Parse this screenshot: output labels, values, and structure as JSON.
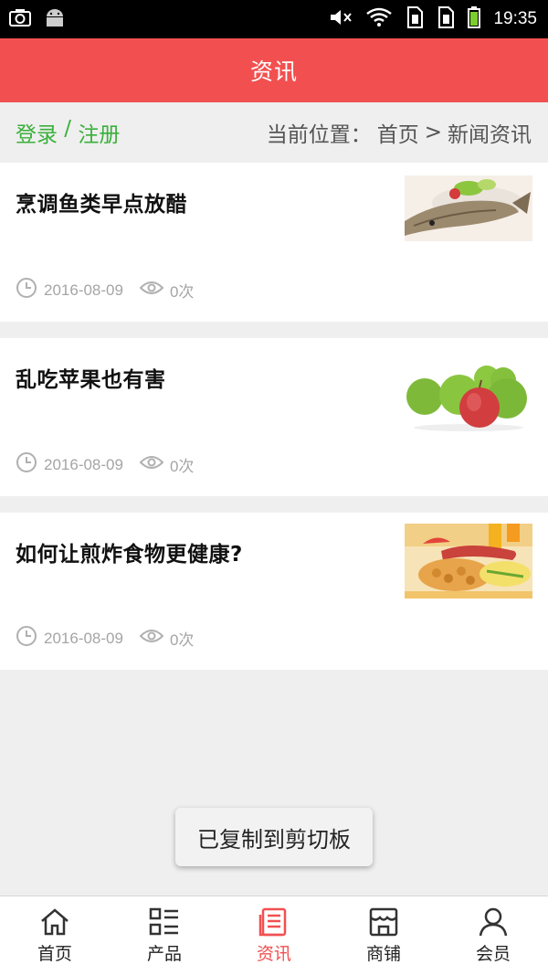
{
  "status_bar": {
    "time": "19:35",
    "icons_left": [
      "screenshot-icon",
      "android-icon"
    ],
    "icons_right": [
      "mute-icon",
      "wifi-icon",
      "sim1-icon",
      "sim2-icon",
      "battery-icon"
    ]
  },
  "header": {
    "title": "资讯"
  },
  "breadcrumb": {
    "login": "登录",
    "separator": " / ",
    "register": "注册",
    "location_label": "当前位置：",
    "home": "首页",
    "arrow": ">",
    "current": "新闻资讯"
  },
  "news": [
    {
      "title": "烹调鱼类早点放醋",
      "date": "2016-08-09",
      "views": "0次",
      "thumb": "fish-dish-image"
    },
    {
      "title": "乱吃苹果也有害",
      "date": "2016-08-09",
      "views": "0次",
      "thumb": "apples-image"
    },
    {
      "title": "如何让煎炸食物更健康?",
      "date": "2016-08-09",
      "views": "0次",
      "thumb": "fried-food-image"
    }
  ],
  "toast": {
    "text": "已复制到剪切板"
  },
  "bottom_nav": [
    {
      "label": "首页",
      "icon": "home-icon",
      "active": false
    },
    {
      "label": "产品",
      "icon": "product-grid-icon",
      "active": false
    },
    {
      "label": "资讯",
      "icon": "news-document-icon",
      "active": true
    },
    {
      "label": "商铺",
      "icon": "shop-icon",
      "active": false
    },
    {
      "label": "会员",
      "icon": "user-icon",
      "active": false
    }
  ],
  "colors": {
    "accent": "#f25050",
    "login_green": "#3ab03a",
    "meta_gray": "#a5a5a5"
  }
}
